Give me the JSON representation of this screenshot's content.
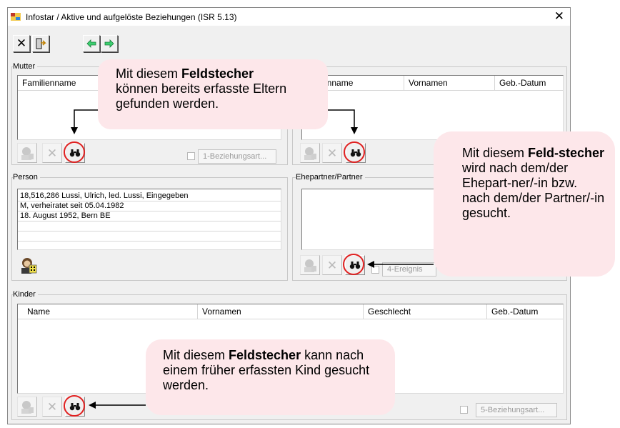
{
  "window": {
    "title": "Infostar / Aktive und aufgelöste Beziehungen (ISR 5.13)",
    "close_icon": "close-x-icon"
  },
  "toolbar": {
    "buttons": [
      {
        "icon": "close-x-icon",
        "name": "toolbar-close-button"
      },
      {
        "icon": "exit-door-arrow-icon",
        "name": "toolbar-exit-button"
      },
      {
        "icon": "arrow-left-icon",
        "name": "toolbar-back-button"
      },
      {
        "icon": "arrow-right-icon",
        "name": "toolbar-forward-button"
      }
    ]
  },
  "mutter": {
    "label": "Mutter",
    "columns": [
      "Familienname"
    ],
    "checkbox_label": "1-Beziehungsart..."
  },
  "vater": {
    "columns": [
      "Familienname",
      "Vornamen",
      "Geb.-Datum"
    ],
    "column_visible_fragment": "enname"
  },
  "person": {
    "label": "Person",
    "rows": [
      "18,516,286  Lussi, Ulrich, led. Lussi, Eingegeben",
      "M, verheiratet seit 05.04.1982",
      "18. August 1952, Bern BE",
      "",
      ""
    ]
  },
  "partner": {
    "label": "Ehepartner/Partner",
    "button_label": "4-Ereignis"
  },
  "kinder": {
    "label": "Kinder",
    "columns": [
      "Name",
      "Vornamen",
      "Geschlecht",
      "Geb.-Datum"
    ],
    "button_label": "5-Beziehungsart..."
  },
  "callouts": {
    "eltern": {
      "pre": "Mit diesem ",
      "bold": "Feldstecher",
      "post": "können bereits erfasste Eltern gefunden werden."
    },
    "partner": {
      "pre": "Mit diesem ",
      "bold": "Feld-stecher",
      "post": "wird nach dem/der Ehepart-ner/-in bzw. nach dem/der Partner/-in gesucht."
    },
    "kind": {
      "pre": "Mit diesem ",
      "bold": "Feldstecher",
      "post": "kann nach einem früher erfassten Kind gesucht werden."
    }
  },
  "colors": {
    "callout_bg": "#fde7ea",
    "highlight_ring": "#e02020",
    "window_bg": "#f0f0f0",
    "arrow_left": "#00b050",
    "arrow_right": "#00b050"
  }
}
